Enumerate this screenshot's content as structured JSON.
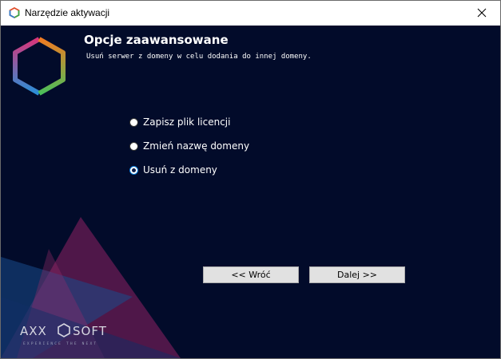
{
  "window": {
    "title": "Narzędzie aktywacji"
  },
  "header": {
    "title": "Opcje zaawansowane",
    "subtitle": "Usuń serwer z domeny w celu dodania do innej domeny."
  },
  "options": [
    {
      "label": "Zapisz plik licencji",
      "checked": false
    },
    {
      "label": "Zmień nazwę domeny",
      "checked": false
    },
    {
      "label": "Usuń z domeny",
      "checked": true
    }
  ],
  "buttons": {
    "back_label": "<< Wróć",
    "next_label": "Dalej >>"
  },
  "brand": {
    "name": "AXXONSOFT",
    "tagline": "EXPERIENCE THE NEXT"
  },
  "colors": {
    "background": "#020b2a",
    "accent_pink": "#8a1f5e",
    "accent_blue": "#1a4a86",
    "radio_selected": "#0078d7"
  },
  "icons": {
    "app": "hexagon-icon",
    "close": "close-icon"
  }
}
